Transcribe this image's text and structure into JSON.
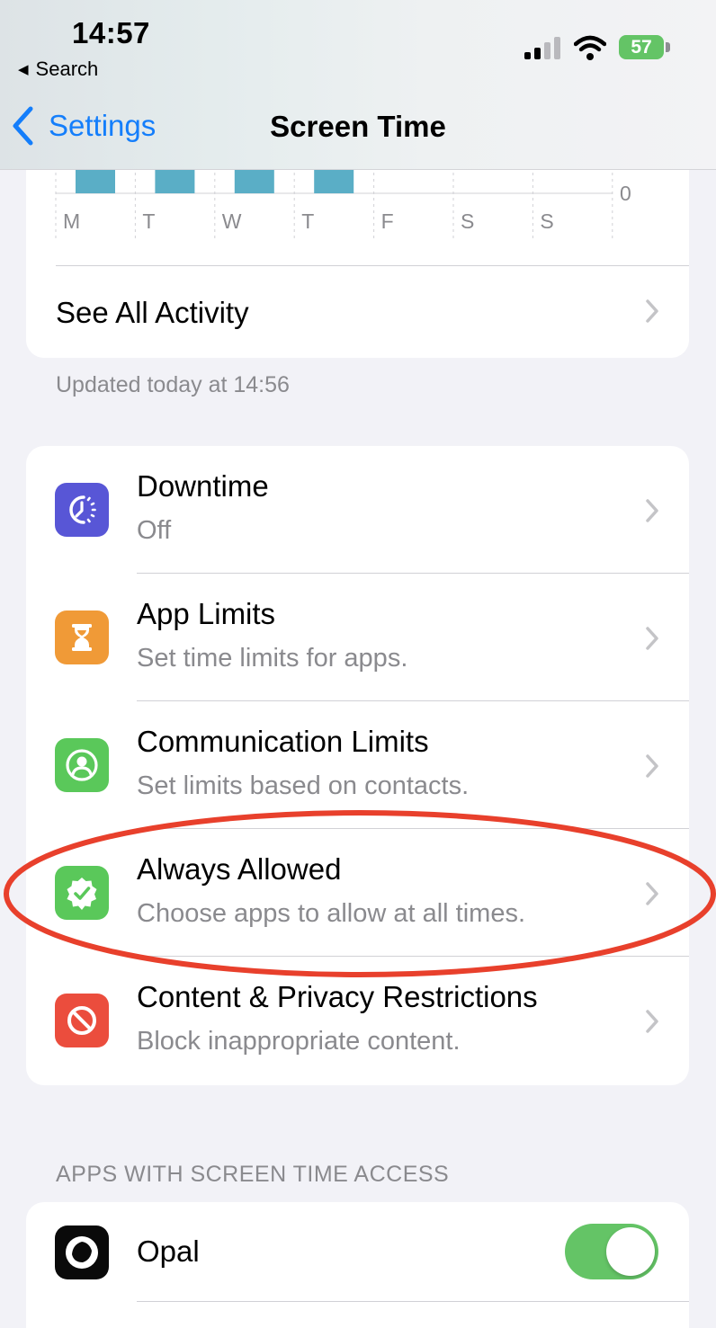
{
  "status_bar": {
    "time": "14:57",
    "back_label": "Search",
    "battery": "57"
  },
  "nav": {
    "back": "Settings",
    "title": "Screen Time"
  },
  "chart": {
    "days": [
      "M",
      "T",
      "W",
      "T",
      "F",
      "S",
      "S"
    ],
    "axis_zero": "0"
  },
  "chart_data": {
    "type": "bar",
    "categories": [
      "M",
      "T",
      "W",
      "T",
      "F",
      "S",
      "S"
    ],
    "ylim_label": "0"
  },
  "activity": {
    "see_all": "See All Activity",
    "updated": "Updated today at 14:56"
  },
  "settings_rows": [
    {
      "title": "Downtime",
      "subtitle": "Off",
      "icon": "downtime-icon",
      "color": "#5856d6"
    },
    {
      "title": "App Limits",
      "subtitle": "Set time limits for apps.",
      "icon": "hourglass-icon",
      "color": "#f09a37"
    },
    {
      "title": "Communication Limits",
      "subtitle": "Set limits based on contacts.",
      "icon": "person-circle-icon",
      "color": "#5ac85a"
    },
    {
      "title": "Always Allowed",
      "subtitle": "Choose apps to allow at all times.",
      "icon": "checkmark-seal-icon",
      "color": "#5ac85a"
    },
    {
      "title": "Content & Privacy Restrictions",
      "subtitle": "Block inappropriate content.",
      "icon": "restricted-icon",
      "color": "#eb4d3d"
    }
  ],
  "apps_section": {
    "header": "APPS WITH SCREEN TIME ACCESS",
    "apps": [
      {
        "name": "Opal",
        "enabled": true
      }
    ]
  },
  "colors": {
    "accent": "#147efb",
    "bar": "#5aaec6",
    "toggle_on": "#64c466",
    "annotation": "#e8402c"
  }
}
